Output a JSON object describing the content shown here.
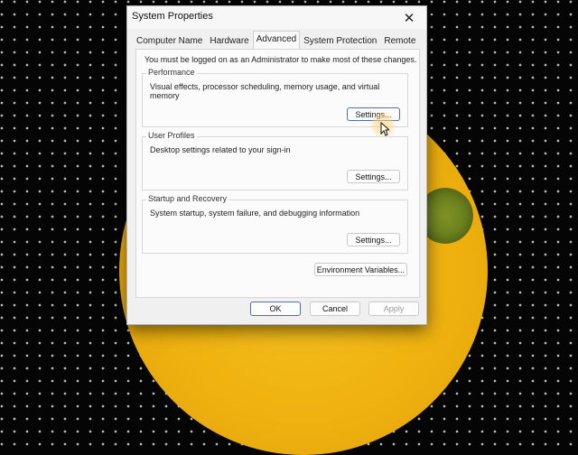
{
  "window": {
    "title": "System Properties"
  },
  "tabs": [
    {
      "label": "Computer Name"
    },
    {
      "label": "Hardware"
    },
    {
      "label": "Advanced"
    },
    {
      "label": "System Protection"
    },
    {
      "label": "Remote"
    }
  ],
  "active_tab": "Advanced",
  "notice": "You must be logged on as an Administrator to make most of these changes.",
  "groups": {
    "performance": {
      "title": "Performance",
      "desc": "Visual effects, processor scheduling, memory usage, and virtual memory",
      "button": "Settings..."
    },
    "user_profiles": {
      "title": "User Profiles",
      "desc": "Desktop settings related to your sign-in",
      "button": "Settings..."
    },
    "startup": {
      "title": "Startup and Recovery",
      "desc": "System startup, system failure, and debugging information",
      "button": "Settings..."
    }
  },
  "env_button": "Environment Variables...",
  "footer": {
    "ok": "OK",
    "cancel": "Cancel",
    "apply": "Apply"
  },
  "icons": {
    "close": "close-icon",
    "cursor": "mouse-pointer-icon"
  },
  "colors": {
    "window_bg": "#f0f0f0",
    "background_disk": "#efb20f",
    "focus_border": "#4c6fb0"
  }
}
